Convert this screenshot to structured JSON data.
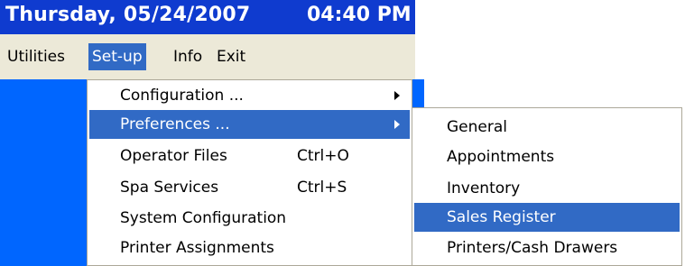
{
  "titlebar": {
    "date": "Thursday, 05/24/2007",
    "time": "04:40 PM"
  },
  "menubar": {
    "items": [
      "Utilities",
      "Set-up",
      "Info",
      "Exit"
    ],
    "active": "Set-up"
  },
  "setup_menu": {
    "items": [
      {
        "label": "Configuration ...",
        "shortcut": "",
        "submenu": true
      },
      {
        "label": "Preferences ...",
        "shortcut": "",
        "submenu": true,
        "highlighted": true
      },
      {
        "label": "Operator Files",
        "shortcut": "Ctrl+O"
      },
      {
        "label": "Spa Services",
        "shortcut": "Ctrl+S"
      },
      {
        "label": "System Configuration",
        "shortcut": ""
      },
      {
        "label": "Printer Assignments",
        "shortcut": ""
      }
    ]
  },
  "preferences_submenu": {
    "items": [
      {
        "label": "General"
      },
      {
        "label": "Appointments"
      },
      {
        "label": "Inventory"
      },
      {
        "label": "Sales Register",
        "highlighted": true
      },
      {
        "label": "Printers/Cash Drawers"
      }
    ]
  },
  "colors": {
    "titlebar": "#0f3bcf",
    "menubar": "#ece9d8",
    "highlight": "#316ac5",
    "desktop": "#0066ff"
  }
}
